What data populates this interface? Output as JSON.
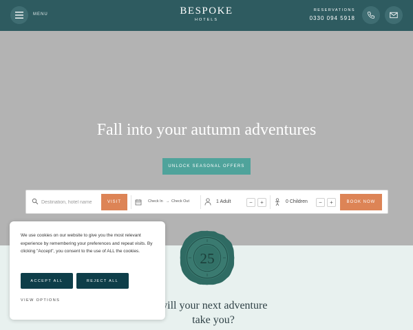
{
  "header": {
    "menu_label": "MENU",
    "brand_name": "BESPOKE",
    "brand_sub": "HOTELS",
    "reservations_label": "RESERVATIONS",
    "reservations_phone": "0330 094 5918",
    "icons": {
      "menu": "hamburger-icon",
      "phone": "phone-icon",
      "mail": "mail-icon"
    },
    "color": "#2e5b60"
  },
  "hero": {
    "title": "Fall into your autumn adventures",
    "cta_label": "UNLOCK SEASONAL OFFERS",
    "cta_color": "#4fa39b"
  },
  "booking": {
    "destination_placeholder": "Destination, hotel name",
    "visit_label": "VISIT",
    "check_in": "Check In",
    "arrow": "→",
    "check_out": "Check Out",
    "adults": "1 Adult",
    "children": "0 Children",
    "minus": "−",
    "plus": "+",
    "book_label": "BOOK NOW",
    "accent_color": "#dd8456"
  },
  "seal": {
    "number": "25",
    "color": "#2f6b63"
  },
  "section": {
    "heading_line1": "will your next adventure",
    "heading_line2": "take you?"
  },
  "cookie": {
    "text": "We use cookies on our website to give you the most relevant experience by remembering your preferences and repeat visits. By clicking \"Accept\", you consent to the use of ALL the cookies.",
    "accept_label": "ACCEPT ALL",
    "reject_label": "REJECT ALL",
    "view_options_label": "VIEW OPTIONS",
    "button_color": "#0e3e49"
  }
}
